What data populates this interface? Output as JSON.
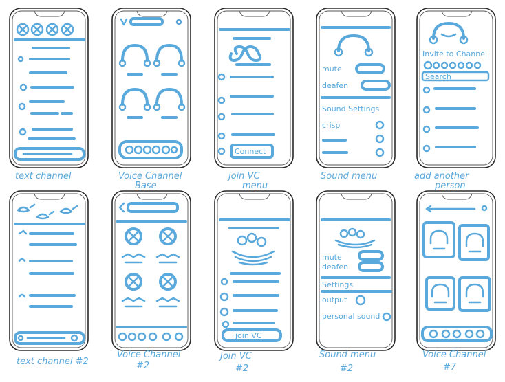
{
  "board": {
    "ink_color": "#5aa9dc",
    "outline_color": "#2a2a2a"
  },
  "captions": {
    "text_channel": "text channel",
    "voice_base_1": "Voice Channel",
    "voice_base_2": "Base",
    "join_vc_1": "join VC",
    "join_vc_2": "menu",
    "sound_menu": "Sound menu",
    "add_person_1": "add another",
    "add_person_2": "person",
    "text_channel_2": "text channel #2",
    "voice_2_1": "Voice Channel",
    "voice_2_2": "#2",
    "join_vc_2b_1": "Join VC",
    "join_vc_2b_2": "#2",
    "sound_menu_2_1": "Sound menu",
    "sound_menu_2_2": "#2",
    "voice_7_1": "Voice Channel",
    "voice_7_2": "#7"
  },
  "screens": {
    "join_vc_connect": "Connect",
    "sound_mute": "mute",
    "sound_deafen": "deafen",
    "sound_settings": "Sound Settings",
    "sound_crisp": "crisp",
    "invite_title": "Invite to Channel",
    "invite_search": "Search",
    "sound2_mute": "mute",
    "sound2_deafen": "deafen",
    "sound2_settings": "Settings",
    "sound2_output": "output",
    "sound2_personalsound": "personal sound",
    "join2_join": "join VC"
  }
}
